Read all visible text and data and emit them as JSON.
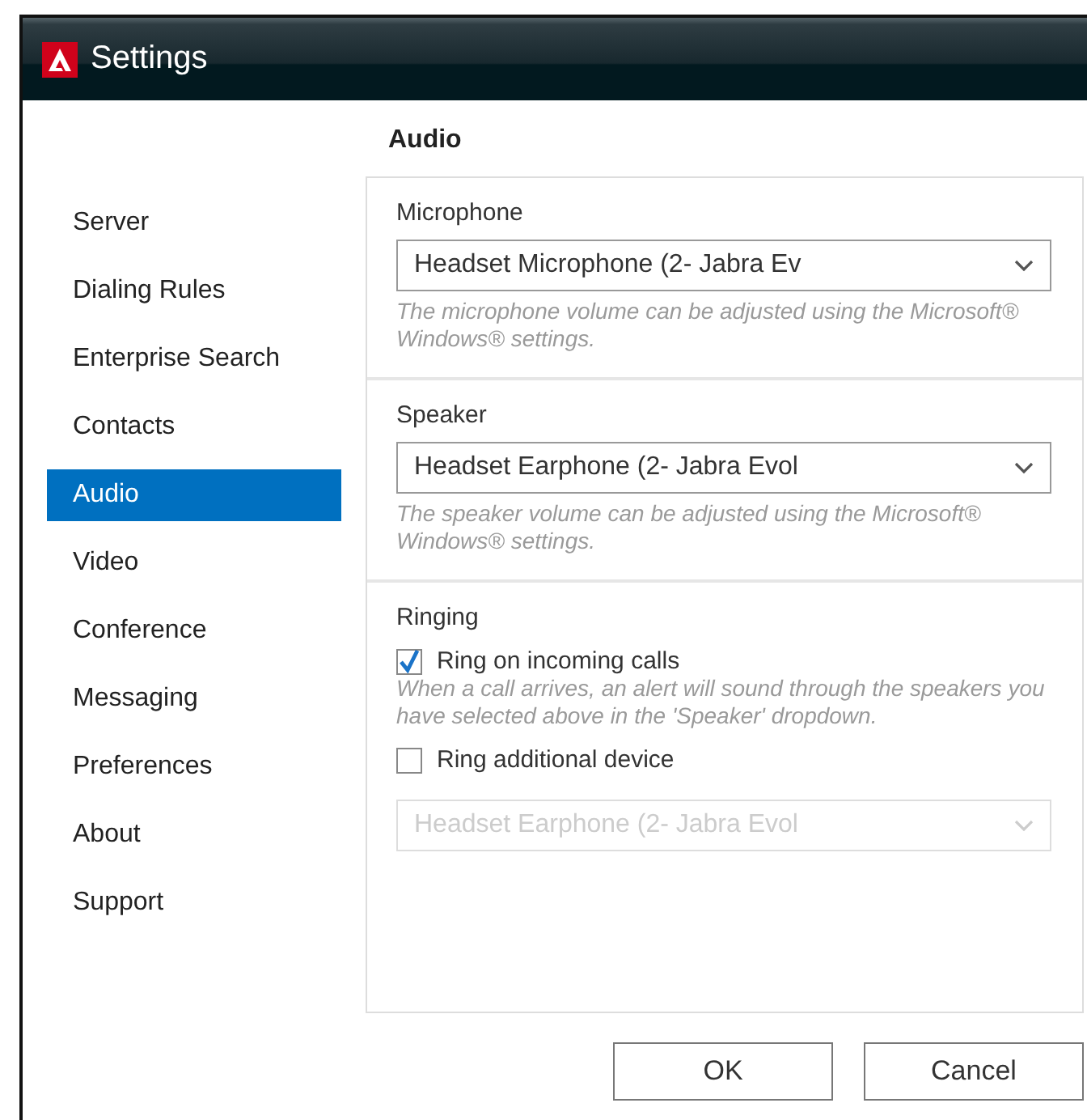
{
  "window": {
    "title": "Settings"
  },
  "sidebar": {
    "items": [
      {
        "label": "Server",
        "selected": false
      },
      {
        "label": "Dialing Rules",
        "selected": false
      },
      {
        "label": "Enterprise Search",
        "selected": false
      },
      {
        "label": "Contacts",
        "selected": false
      },
      {
        "label": "Audio",
        "selected": true
      },
      {
        "label": "Video",
        "selected": false
      },
      {
        "label": "Conference",
        "selected": false
      },
      {
        "label": "Messaging",
        "selected": false
      },
      {
        "label": "Preferences",
        "selected": false
      },
      {
        "label": "About",
        "selected": false
      },
      {
        "label": "Support",
        "selected": false
      }
    ]
  },
  "page": {
    "heading": "Audio",
    "sections": [
      {
        "kind": "device",
        "title": "Microphone",
        "select": {
          "value": "Headset Microphone (2- Jabra Ev",
          "disabled": false
        },
        "note": "The microphone volume can be adjusted using the Microsoft® Windows® settings."
      },
      {
        "kind": "device",
        "title": "Speaker",
        "select": {
          "value": "Headset Earphone (2- Jabra Evol",
          "disabled": false
        },
        "note": "The speaker volume can be adjusted using the Microsoft® Windows® settings."
      },
      {
        "kind": "ringing",
        "title": "Ringing",
        "options": [
          {
            "label": "Ring on incoming calls",
            "checked": true,
            "note": "When a call arrives, an alert will sound through the speakers you have selected above in the 'Speaker' dropdown."
          },
          {
            "label": "Ring additional device",
            "checked": false
          }
        ],
        "select": {
          "value": "Headset Earphone (2- Jabra Evol",
          "disabled": true
        }
      }
    ]
  },
  "buttons": [
    {
      "label": "OK"
    },
    {
      "label": "Cancel"
    }
  ]
}
